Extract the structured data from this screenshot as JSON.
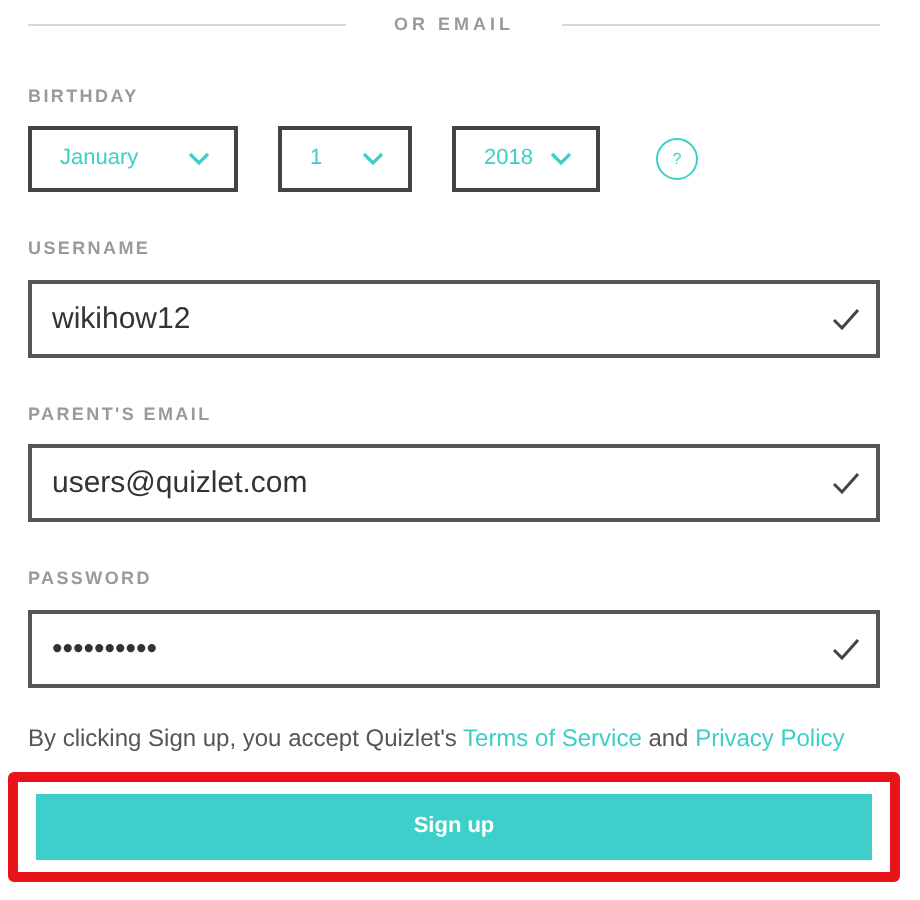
{
  "divider": {
    "label": "OR EMAIL"
  },
  "birthday": {
    "label": "BIRTHDAY",
    "selects": [
      {
        "value": "January"
      },
      {
        "value": "1"
      },
      {
        "value": "2018"
      }
    ],
    "help": "?"
  },
  "fields": [
    {
      "label": "USERNAME",
      "value": "wikihow12",
      "valid": true
    },
    {
      "label": "PARENT'S EMAIL",
      "value": "users@quizlet.com",
      "valid": true
    },
    {
      "label": "PASSWORD",
      "value": "••••••••••",
      "valid": true
    }
  ],
  "terms": {
    "text": "By clicking Sign up, you accept Quizlet's ",
    "link1": "Terms of Service",
    "middle": " and ",
    "link2": "Privacy Policy"
  },
  "signup": {
    "label": "Sign up",
    "highlighted": true
  }
}
